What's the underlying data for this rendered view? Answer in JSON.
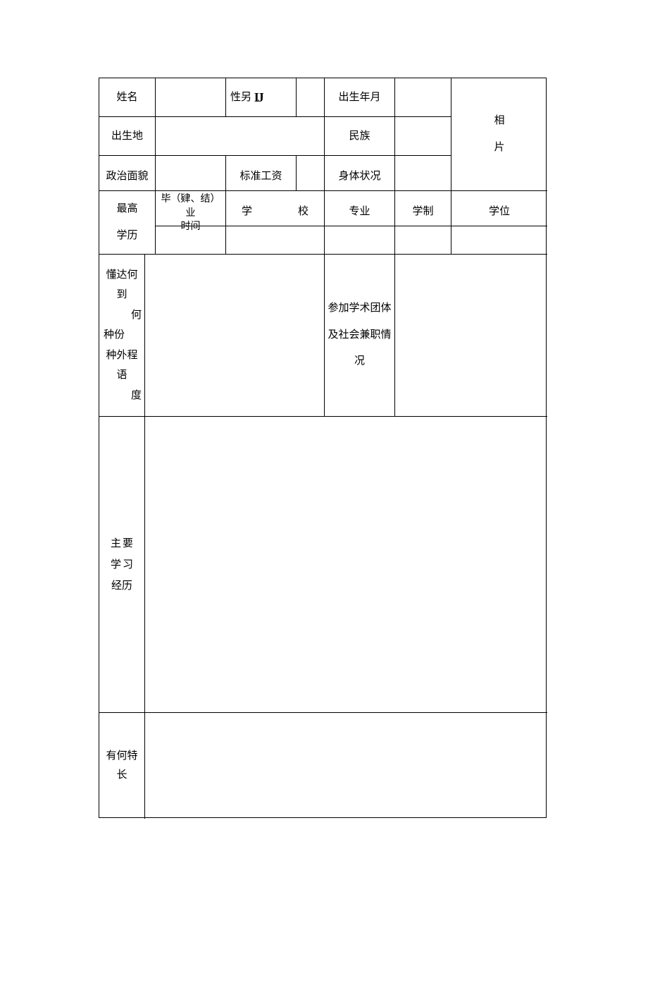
{
  "labels": {
    "name": "姓名",
    "sex_prefix": "性另",
    "sex_suffix": "IJ",
    "birth": "出生年月",
    "birthplace": "出生地",
    "ethnicity": "民族",
    "photo_l1": "相",
    "photo_l2": "片",
    "politics": "政治面貌",
    "salary": "标准工资",
    "health": "身体状况",
    "edu_top": "最高",
    "edu_bottom": "学历",
    "grad_time_l1": "毕（肄、结）业",
    "grad_time_l2": "时间",
    "school_a": "学",
    "school_b": "校",
    "major": "专业",
    "system": "学制",
    "degree": "学位",
    "lang_l1": "懂达何到",
    "lang_l2": "何",
    "lang_l3": "种份",
    "lang_l4": "种外程语",
    "lang_l5": "度",
    "assoc_l1": "参加学术团体",
    "assoc_l2": "及社会兼职情",
    "assoc_l3": "况",
    "study_a": "主",
    "study_b": "要",
    "study_c": "学",
    "study_d": "习",
    "study_e": "经历",
    "specialty": "有何特长"
  },
  "values": {
    "name": "",
    "sex": "",
    "birth": "",
    "birthplace": "",
    "ethnicity": "",
    "politics": "",
    "salary": "",
    "health": "",
    "grad_time": "",
    "school": "",
    "major": "",
    "system": "",
    "degree": "",
    "languages": "",
    "associations": "",
    "study_history": "",
    "specialty": ""
  }
}
